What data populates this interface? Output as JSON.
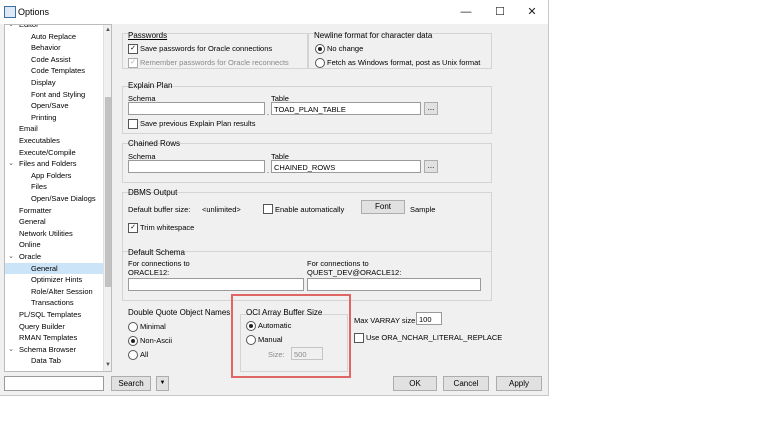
{
  "window": {
    "title": "Options",
    "minimize": "—",
    "maximize": "☐",
    "close": "✕"
  },
  "tree": {
    "items": [
      {
        "label": "Editor",
        "expandable": true,
        "level": 0
      },
      {
        "label": "Auto Replace",
        "level": 1
      },
      {
        "label": "Behavior",
        "level": 1
      },
      {
        "label": "Code Assist",
        "level": 1
      },
      {
        "label": "Code Templates",
        "level": 1
      },
      {
        "label": "Display",
        "level": 1
      },
      {
        "label": "Font and Styling",
        "level": 1
      },
      {
        "label": "Open/Save",
        "level": 1
      },
      {
        "label": "Printing",
        "level": 1
      },
      {
        "label": "Email",
        "level": 0
      },
      {
        "label": "Executables",
        "level": 0
      },
      {
        "label": "Execute/Compile",
        "level": 0
      },
      {
        "label": "Files and Folders",
        "expandable": true,
        "level": 0
      },
      {
        "label": "App Folders",
        "level": 1
      },
      {
        "label": "Files",
        "level": 1
      },
      {
        "label": "Open/Save Dialogs",
        "level": 1
      },
      {
        "label": "Formatter",
        "level": 0
      },
      {
        "label": "General",
        "level": 0
      },
      {
        "label": "Network Utilities",
        "level": 0
      },
      {
        "label": "Online",
        "level": 0
      },
      {
        "label": "Oracle",
        "expandable": true,
        "level": 0
      },
      {
        "label": "General",
        "level": 1,
        "selected": true
      },
      {
        "label": "Optimizer Hints",
        "level": 1
      },
      {
        "label": "Role/Alter Session",
        "level": 1
      },
      {
        "label": "Transactions",
        "level": 1
      },
      {
        "label": "PL/SQL Templates",
        "level": 0
      },
      {
        "label": "Query Builder",
        "level": 0
      },
      {
        "label": "RMAN Templates",
        "level": 0
      },
      {
        "label": "Schema Browser",
        "expandable": true,
        "level": 0
      },
      {
        "label": "Data Tab",
        "level": 1
      }
    ]
  },
  "passwords": {
    "title": "Passwords",
    "save": "Save passwords for Oracle connections",
    "remember": "Remember passwords for Oracle reconnects"
  },
  "newline": {
    "title": "Newline format for character data",
    "no_change": "No change",
    "fetch_windows": "Fetch as Windows format, post as Unix format"
  },
  "explain_plan": {
    "title": "Explain Plan",
    "schema_label": "Schema",
    "table_label": "Table",
    "table_value": "TOAD_PLAN_TABLE",
    "browse": "...",
    "save_results": "Save previous Explain Plan results"
  },
  "chained_rows": {
    "title": "Chained Rows",
    "schema_label": "Schema",
    "table_label": "Table",
    "table_value": "CHAINED_ROWS",
    "browse": "..."
  },
  "dbms_output": {
    "title": "DBMS Output",
    "buffer_label": "Default buffer size:",
    "buffer_value": "<unlimited>",
    "enable_auto": "Enable automatically",
    "font_button": "Font",
    "sample": "Sample",
    "trim": "Trim whitespace"
  },
  "default_schema": {
    "title": "Default Schema",
    "conn1": "For connections to\nORACLE12:",
    "conn2": "For connections to\nQUEST_DEV@ORACLE12:"
  },
  "double_quote": {
    "title": "Double Quote Object Names",
    "minimal": "Minimal",
    "non_ascii": "Non-Ascii",
    "all": "All"
  },
  "oci": {
    "title": "OCI Array Buffer Size",
    "automatic": "Automatic",
    "manual": "Manual",
    "size_label": "Size:",
    "size_value": "500"
  },
  "varray": {
    "label": "Max VARRAY size:",
    "value": "100"
  },
  "nchar": {
    "label": "Use ORA_NCHAR_LITERAL_REPLACE"
  },
  "footer": {
    "search_button": "Search",
    "dropdown": "▼",
    "ok": "OK",
    "cancel": "Cancel",
    "apply": "Apply"
  },
  "colors": {
    "highlight": "#e06666",
    "selection": "#cce4f7"
  }
}
